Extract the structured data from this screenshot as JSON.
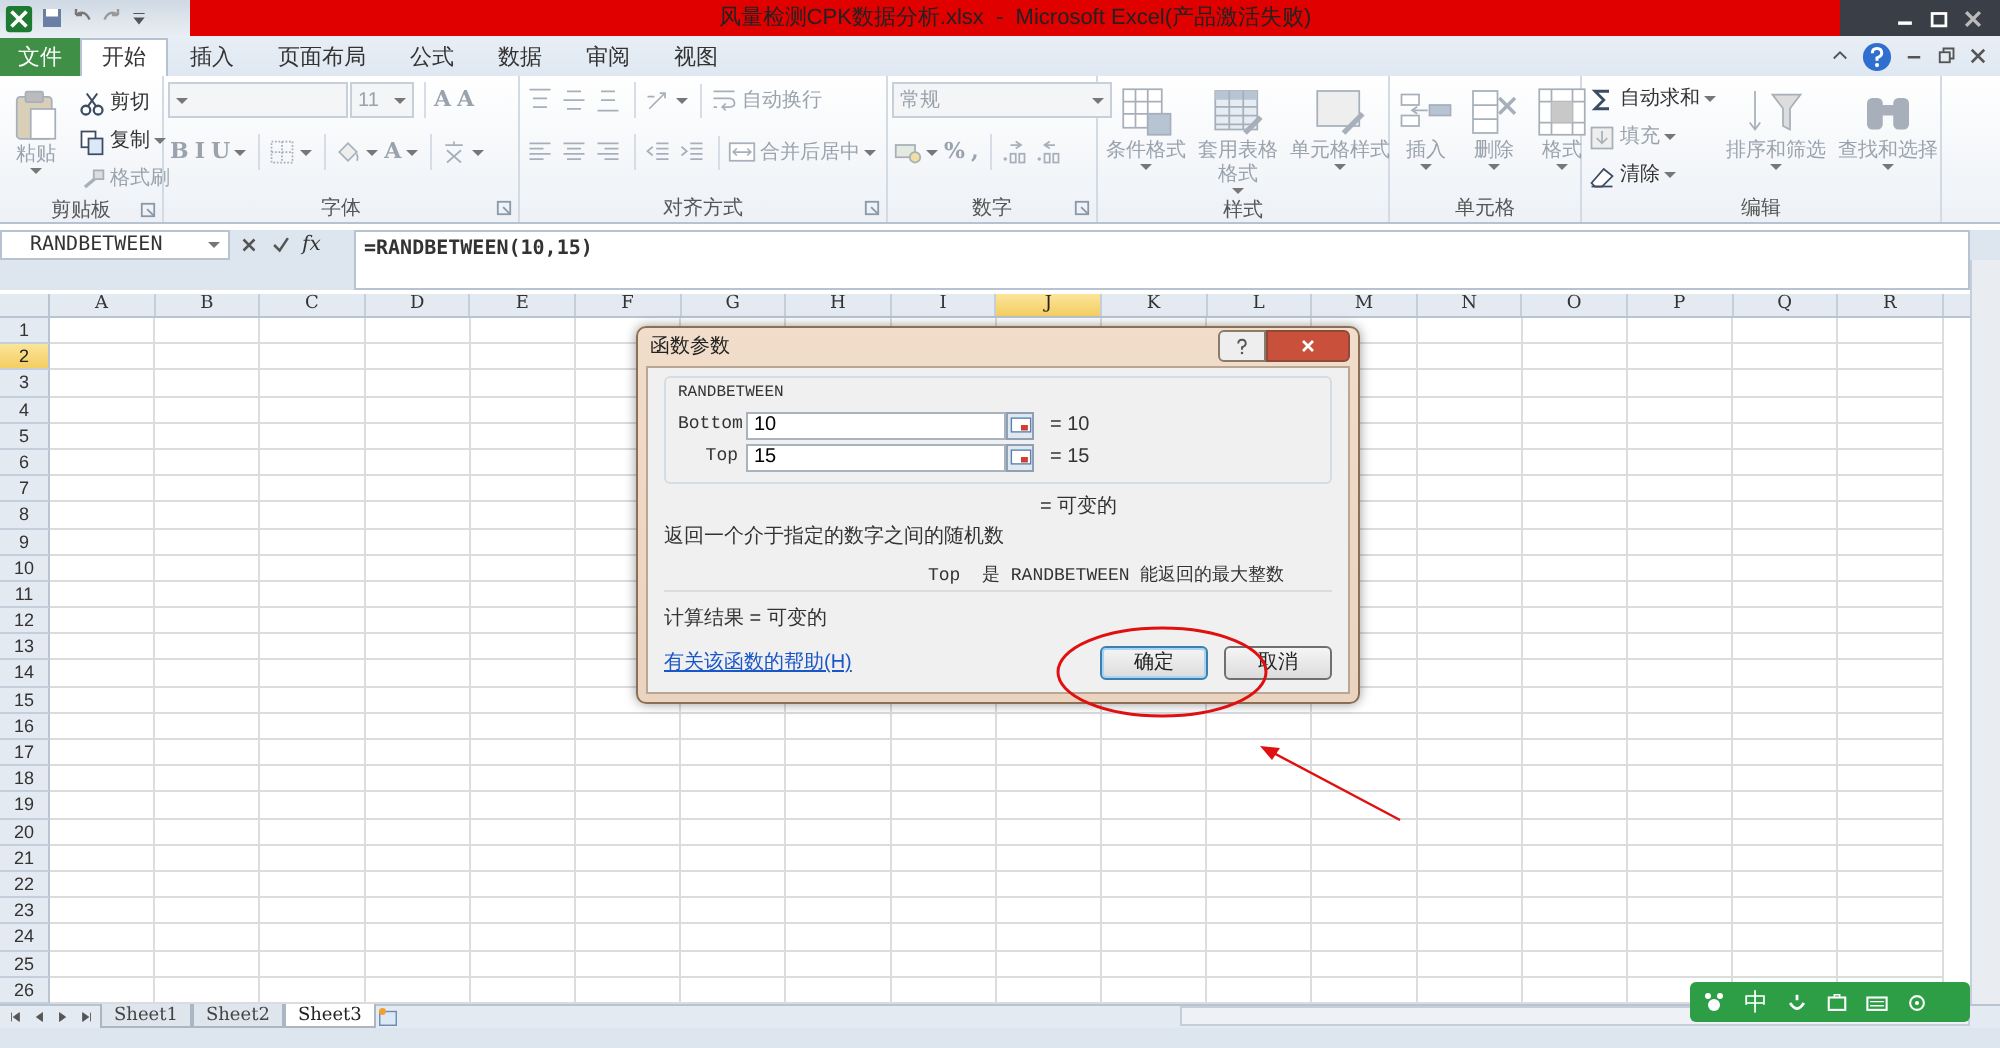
{
  "window": {
    "title": "风量检测CPK数据分析.xlsx  -  Microsoft Excel(产品激活失败)"
  },
  "ribbon_tabs": [
    {
      "label": "文件",
      "kind": "file",
      "selected": false
    },
    {
      "label": "开始",
      "kind": "tab",
      "selected": true
    },
    {
      "label": "插入",
      "kind": "tab",
      "selected": false
    },
    {
      "label": "页面布局",
      "kind": "tab",
      "selected": false
    },
    {
      "label": "公式",
      "kind": "tab",
      "selected": false
    },
    {
      "label": "数据",
      "kind": "tab",
      "selected": false
    },
    {
      "label": "审阅",
      "kind": "tab",
      "selected": false
    },
    {
      "label": "视图",
      "kind": "tab",
      "selected": false
    }
  ],
  "ribbon_groups": [
    {
      "label": "剪贴板",
      "launcher": true,
      "columns": [
        [
          {
            "kind": "large",
            "label": "粘贴",
            "disabled": true,
            "dropdown": true
          }
        ],
        [
          {
            "kind": "small",
            "label": "剪切",
            "disabled": false,
            "dropdown": false
          },
          {
            "kind": "small",
            "label": "复制",
            "disabled": false,
            "dropdown": true
          },
          {
            "kind": "small",
            "label": "格式刷",
            "disabled": true,
            "dropdown": false
          }
        ]
      ]
    },
    {
      "label": "字体",
      "launcher": true,
      "rows": [
        [
          [
            {
              "kind": "field",
              "disabled": true,
              "dropdown": true
            },
            {
              "kind": "field",
              "value": "11",
              "disabled": true,
              "dropdown": true
            }
          ],
          [
            {
              "kind": "icon",
              "label": "A",
              "disabled": true,
              "dropdown": false
            },
            {
              "kind": "icon",
              "label": "A",
              "disabled": true,
              "dropdown": false
            }
          ]
        ],
        [
          [
            {
              "kind": "icon",
              "label": "B",
              "disabled": true,
              "dropdown": false
            },
            {
              "kind": "icon",
              "label": "I",
              "disabled": true,
              "dropdown": false
            },
            {
              "kind": "icon",
              "label": "U",
              "disabled": true,
              "dropdown": true
            }
          ],
          [
            {
              "kind": "icon",
              "disabled": true,
              "dropdown": true
            }
          ],
          [
            {
              "kind": "icon",
              "disabled": true,
              "dropdown": true
            },
            {
              "kind": "icon",
              "label": "A",
              "disabled": true,
              "dropdown": true
            }
          ],
          [
            {
              "kind": "icon",
              "disabled": true,
              "dropdown": true
            }
          ]
        ]
      ]
    },
    {
      "label": "对齐方式",
      "launcher": true,
      "rows": [
        [
          [
            {
              "kind": "icon",
              "disabled": true,
              "dropdown": false
            },
            {
              "kind": "icon",
              "disabled": true,
              "dropdown": false
            },
            {
              "kind": "icon",
              "disabled": true,
              "dropdown": false
            }
          ],
          [
            {
              "kind": "icon",
              "disabled": true,
              "dropdown": true
            }
          ],
          [
            {
              "kind": "small",
              "label": "自动换行",
              "disabled": true,
              "dropdown": false
            }
          ]
        ],
        [
          [
            {
              "kind": "icon",
              "disabled": true,
              "dropdown": false
            },
            {
              "kind": "icon",
              "disabled": true,
              "dropdown": false
            },
            {
              "kind": "icon",
              "disabled": true,
              "dropdown": false
            }
          ],
          [
            {
              "kind": "icon",
              "disabled": true,
              "dropdown": false
            },
            {
              "kind": "icon",
              "disabled": true,
              "dropdown": false
            }
          ],
          [
            {
              "kind": "small",
              "label": "合并后居中",
              "disabled": true,
              "dropdown": true
            }
          ]
        ]
      ]
    },
    {
      "label": "数字",
      "launcher": true,
      "rows": [
        [
          [
            {
              "kind": "field",
              "value": "常规",
              "disabled": true,
              "dropdown": true
            }
          ]
        ],
        [
          [
            {
              "kind": "icon",
              "disabled": true,
              "dropdown": true
            },
            {
              "kind": "icon",
              "label": "%",
              "disabled": true,
              "dropdown": false
            },
            {
              "kind": "icon",
              "label": ",",
              "disabled": true,
              "dropdown": false
            }
          ],
          [
            {
              "kind": "icon",
              "disabled": true,
              "dropdown": false
            },
            {
              "kind": "icon",
              "disabled": true,
              "dropdown": false
            }
          ]
        ]
      ]
    },
    {
      "label": "样式",
      "launcher": false,
      "columns": [
        [
          {
            "kind": "large",
            "label": "条件格式",
            "disabled": true,
            "dropdown": true
          }
        ],
        [
          {
            "kind": "large",
            "label": "套用表格格式",
            "disabled": true,
            "dropdown": true
          }
        ],
        [
          {
            "kind": "large",
            "label": "单元格样式",
            "disabled": true,
            "dropdown": true
          }
        ]
      ]
    },
    {
      "label": "单元格",
      "launcher": false,
      "columns": [
        [
          {
            "kind": "large",
            "label": "插入",
            "disabled": true,
            "dropdown": true
          }
        ],
        [
          {
            "kind": "large",
            "label": "删除",
            "disabled": true,
            "dropdown": true
          }
        ],
        [
          {
            "kind": "large",
            "label": "格式",
            "disabled": true,
            "dropdown": true
          }
        ]
      ]
    },
    {
      "label": "编辑",
      "launcher": false,
      "columns": [
        [
          {
            "kind": "small",
            "label": "自动求和",
            "disabled": false,
            "dropdown": true
          },
          {
            "kind": "small",
            "label": "填充",
            "disabled": true,
            "dropdown": true
          },
          {
            "kind": "small",
            "label": "清除",
            "disabled": false,
            "dropdown": true
          }
        ],
        [
          {
            "kind": "large",
            "label": "排序和筛选",
            "disabled": true,
            "dropdown": true
          }
        ],
        [
          {
            "kind": "large",
            "label": "查找和选择",
            "disabled": true,
            "dropdown": true
          }
        ]
      ]
    }
  ],
  "formula_bar": {
    "name_box": "RANDBETWEEN",
    "function_label": "fx",
    "formula": "=RANDBETWEEN(10,15)"
  },
  "columns": [
    {
      "label": "A",
      "selected": false
    },
    {
      "label": "B",
      "selected": false
    },
    {
      "label": "C",
      "selected": false
    },
    {
      "label": "D",
      "selected": false
    },
    {
      "label": "E",
      "selected": false
    },
    {
      "label": "F",
      "selected": false
    },
    {
      "label": "G",
      "selected": false
    },
    {
      "label": "H",
      "selected": false
    },
    {
      "label": "I",
      "selected": false
    },
    {
      "label": "J",
      "selected": true
    },
    {
      "label": "K",
      "selected": false
    },
    {
      "label": "L",
      "selected": false
    },
    {
      "label": "M",
      "selected": false
    },
    {
      "label": "N",
      "selected": false
    },
    {
      "label": "O",
      "selected": false
    },
    {
      "label": "P",
      "selected": false
    },
    {
      "label": "Q",
      "selected": false
    },
    {
      "label": "R",
      "selected": false
    }
  ],
  "rows": [
    {
      "label": "1",
      "selected": false
    },
    {
      "label": "2",
      "selected": true
    },
    {
      "label": "3",
      "selected": false
    },
    {
      "label": "4",
      "selected": false
    },
    {
      "label": "5",
      "selected": false
    },
    {
      "label": "6",
      "selected": false
    },
    {
      "label": "7",
      "selected": false
    },
    {
      "label": "8",
      "selected": false
    },
    {
      "label": "9",
      "selected": false
    },
    {
      "label": "10",
      "selected": false
    },
    {
      "label": "11",
      "selected": false
    },
    {
      "label": "12",
      "selected": false
    },
    {
      "label": "13",
      "selected": false
    },
    {
      "label": "14",
      "selected": false
    },
    {
      "label": "15",
      "selected": false
    },
    {
      "label": "16",
      "selected": false
    },
    {
      "label": "17",
      "selected": false
    },
    {
      "label": "18",
      "selected": false
    },
    {
      "label": "19",
      "selected": false
    },
    {
      "label": "20",
      "selected": false
    },
    {
      "label": "21",
      "selected": false
    },
    {
      "label": "22",
      "selected": false
    },
    {
      "label": "23",
      "selected": false
    },
    {
      "label": "24",
      "selected": false
    },
    {
      "label": "25",
      "selected": false
    },
    {
      "label": "26",
      "selected": false
    }
  ],
  "sheet_tabs": [
    {
      "label": "Sheet1",
      "selected": false
    },
    {
      "label": "Sheet2",
      "selected": false
    },
    {
      "label": "Sheet3",
      "selected": true
    }
  ],
  "dialog": {
    "title": "函数参数",
    "function_name": "RANDBETWEEN",
    "arguments": [
      {
        "label": "Bottom",
        "value": "10",
        "result": "= 10"
      },
      {
        "label": "Top",
        "value": "15",
        "result": "= 15"
      }
    ],
    "formula_result": "= 可变的",
    "description": "返回一个介于指定的数字之间的随机数",
    "argument_help": "Top  是 RANDBETWEEN 能返回的最大整数",
    "calculation_result": "计算结果 =  可变的",
    "help_link": "有关该函数的帮助(H)",
    "buttons": [
      {
        "label": "确定",
        "kind": "ok"
      },
      {
        "label": "取消",
        "kind": "cancel"
      }
    ]
  },
  "ime_toolbar": {
    "mode": "中"
  }
}
